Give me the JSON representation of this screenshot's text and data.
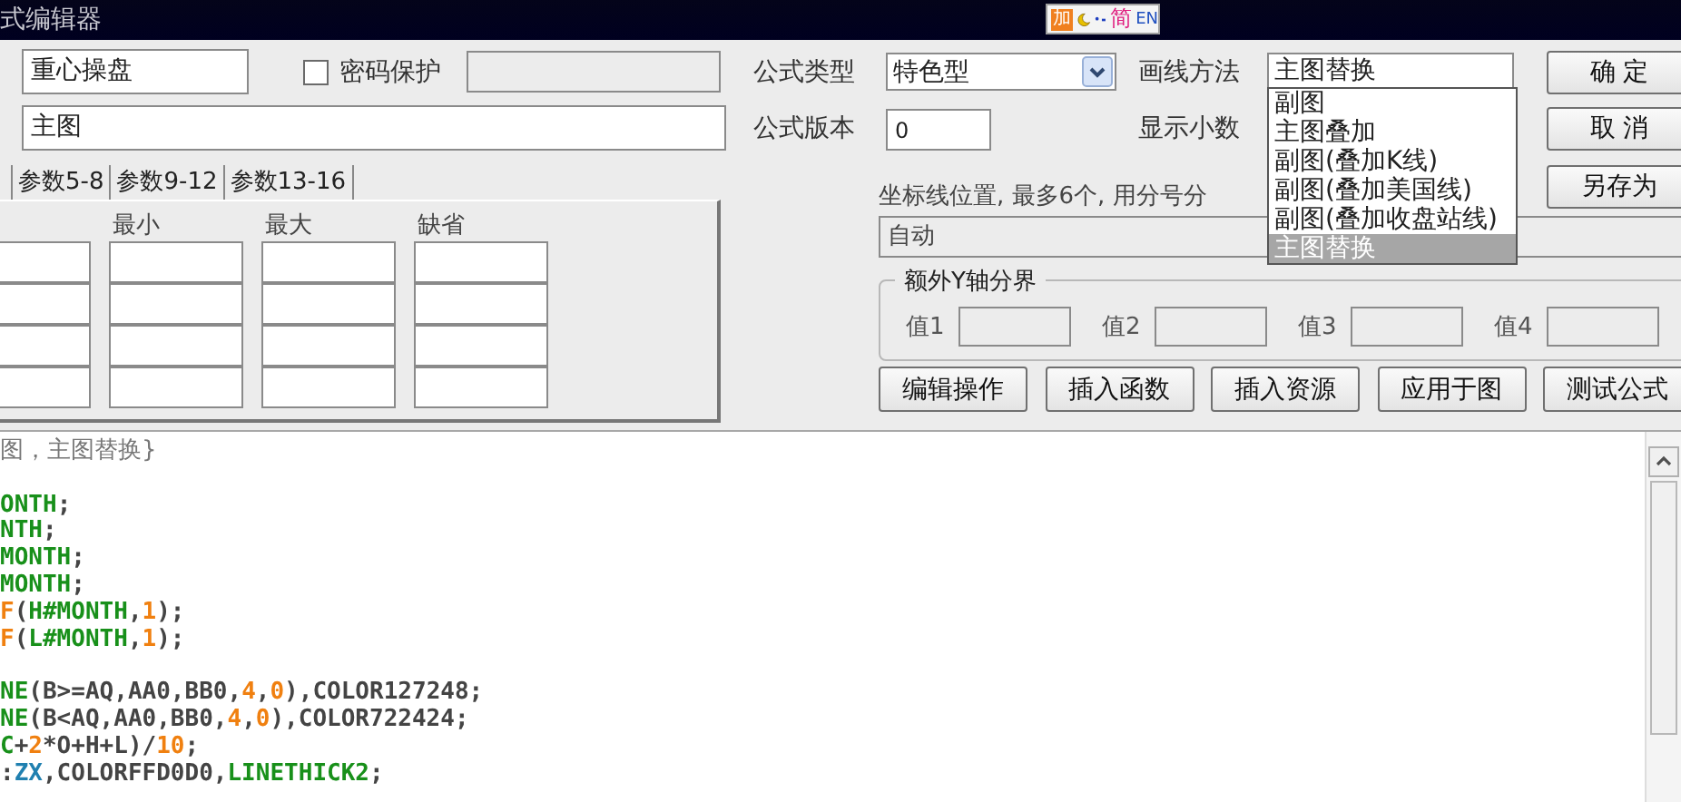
{
  "window": {
    "title": "式编辑器"
  },
  "ime_toolbar": {
    "mode": "加",
    "lang": "简",
    "layout": "EN"
  },
  "name_field": {
    "value": "重心操盘"
  },
  "password_protect": {
    "label": "密码保护",
    "checked": false
  },
  "description_field": {
    "value": "主图"
  },
  "param_tabs": [
    {
      "label": "参数5-8",
      "selected": false
    },
    {
      "label": "参数9-12",
      "selected": false
    },
    {
      "label": "参数13-16",
      "selected": false
    }
  ],
  "param_table": {
    "columns": [
      "最小",
      "最大",
      "缺省"
    ]
  },
  "formula_type": {
    "label": "公式类型",
    "value": "特色型"
  },
  "formula_version": {
    "label": "公式版本",
    "value": "0"
  },
  "draw_method": {
    "label": "画线方法",
    "value": "主图替换",
    "expanded": true,
    "options": [
      {
        "label": "副图",
        "selected": false
      },
      {
        "label": "主图叠加",
        "selected": false
      },
      {
        "label": "副图(叠加K线)",
        "selected": false
      },
      {
        "label": "副图(叠加美国线)",
        "selected": false
      },
      {
        "label": "副图(叠加收盘站线)",
        "selected": false
      },
      {
        "label": "主图替换",
        "selected": true
      }
    ]
  },
  "show_decimals": {
    "label": "显示小数"
  },
  "side_buttons": [
    "确 定",
    "取 消",
    "另存为"
  ],
  "axis_note": "坐标线位置, 最多6个, 用分号分",
  "axis_field": {
    "value": "自动"
  },
  "extra_y_axis": {
    "title": "额外Y轴分界",
    "fields": [
      {
        "label": "值1"
      },
      {
        "label": "值2"
      },
      {
        "label": "值3"
      },
      {
        "label": "值4"
      }
    ]
  },
  "action_buttons": [
    "编辑操作",
    "插入函数",
    "插入资源",
    "应用于图",
    "测试公式"
  ],
  "code_lines": [
    {
      "segments": [
        {
          "kind": "comment",
          "text": "图，主图替换}"
        }
      ]
    },
    {
      "kind": "blank"
    },
    {
      "segments": [
        {
          "kind": "keyword",
          "text": "ONTH"
        },
        {
          "kind": "plain",
          "text": ";"
        }
      ]
    },
    {
      "segments": [
        {
          "kind": "keyword",
          "text": "NTH"
        },
        {
          "kind": "plain",
          "text": ";"
        }
      ]
    },
    {
      "segments": [
        {
          "kind": "keyword",
          "text": "MONTH"
        },
        {
          "kind": "plain",
          "text": ";"
        }
      ]
    },
    {
      "segments": [
        {
          "kind": "keyword",
          "text": "MONTH"
        },
        {
          "kind": "plain",
          "text": ";"
        }
      ]
    },
    {
      "segments": [
        {
          "kind": "number",
          "text": "F"
        },
        {
          "kind": "plain",
          "text": "("
        },
        {
          "kind": "keyword",
          "text": "H#MONTH"
        },
        {
          "kind": "plain",
          "text": ","
        },
        {
          "kind": "number",
          "text": "1"
        },
        {
          "kind": "plain",
          "text": ");"
        }
      ]
    },
    {
      "segments": [
        {
          "kind": "number",
          "text": "F"
        },
        {
          "kind": "plain",
          "text": "("
        },
        {
          "kind": "keyword",
          "text": "L#MONTH"
        },
        {
          "kind": "plain",
          "text": ","
        },
        {
          "kind": "number",
          "text": "1"
        },
        {
          "kind": "plain",
          "text": ");"
        }
      ]
    },
    {
      "kind": "blank"
    },
    {
      "segments": [
        {
          "kind": "keyword",
          "text": "NE"
        },
        {
          "kind": "plain",
          "text": "(B>=AQ,AA0,BB0,"
        },
        {
          "kind": "number",
          "text": "4"
        },
        {
          "kind": "plain",
          "text": ","
        },
        {
          "kind": "number",
          "text": "0"
        },
        {
          "kind": "plain",
          "text": "),COLOR127248;"
        }
      ]
    },
    {
      "segments": [
        {
          "kind": "keyword",
          "text": "NE"
        },
        {
          "kind": "plain",
          "text": "(B<AQ,AA0,BB0,"
        },
        {
          "kind": "number",
          "text": "4"
        },
        {
          "kind": "plain",
          "text": ","
        },
        {
          "kind": "number",
          "text": "0"
        },
        {
          "kind": "plain",
          "text": "),COLOR722424;"
        }
      ]
    },
    {
      "segments": [
        {
          "kind": "keyword",
          "text": "C"
        },
        {
          "kind": "plain",
          "text": "+"
        },
        {
          "kind": "number",
          "text": "2"
        },
        {
          "kind": "plain",
          "text": "*O+H+L)/"
        },
        {
          "kind": "number",
          "text": "10"
        },
        {
          "kind": "plain",
          "text": ";"
        }
      ]
    },
    {
      "segments": [
        {
          "kind": "plain",
          "text": ":"
        },
        {
          "kind": "variable",
          "text": "ZX"
        },
        {
          "kind": "plain",
          "text": ",COLORFFD0D0,"
        },
        {
          "kind": "keyword",
          "text": "LINETHICK2"
        },
        {
          "kind": "plain",
          "text": ";"
        }
      ]
    }
  ]
}
